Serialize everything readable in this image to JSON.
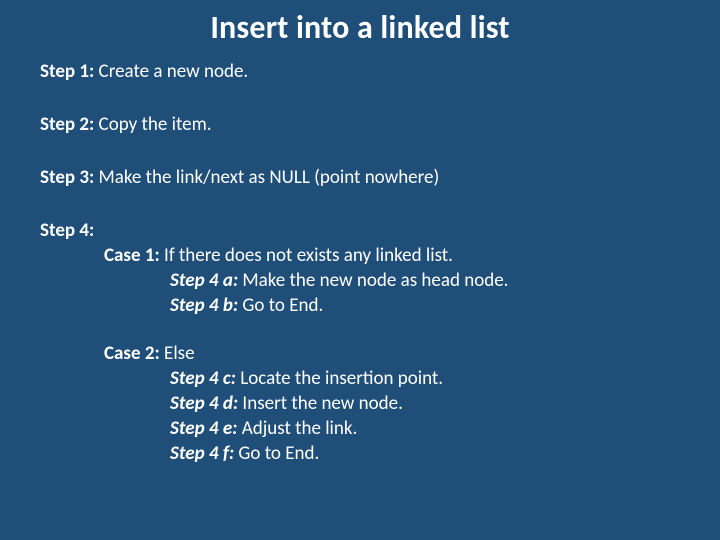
{
  "title": "Insert into a linked list",
  "steps": {
    "s1_label": "Step 1:",
    "s1_text": " Create a new node.",
    "s2_label": "Step 2:",
    "s2_text": " Copy the item.",
    "s3_label": "Step 3:",
    "s3_text": " Make the link/next as NULL (point nowhere)",
    "s4_label": "Step 4:",
    "case1_label": "Case 1:",
    "case1_text": " If there does not exists any linked list.",
    "s4a_label": "Step 4 a:",
    "s4a_text": " Make the new node as head node.",
    "s4b_label": "Step 4 b:",
    "s4b_text": " Go to End.",
    "case2_label": "Case 2: ",
    "case2_text": "Else",
    "s4c_label": "Step 4 c:",
    "s4c_text": " Locate the insertion point.",
    "s4d_label": "Step 4 d:",
    "s4d_text": " Insert the new node.",
    "s4e_label": "Step 4 e:",
    "s4e_text": " Adjust the link.",
    "s4f_label": "Step 4 f:",
    "s4f_text": " Go to End."
  }
}
